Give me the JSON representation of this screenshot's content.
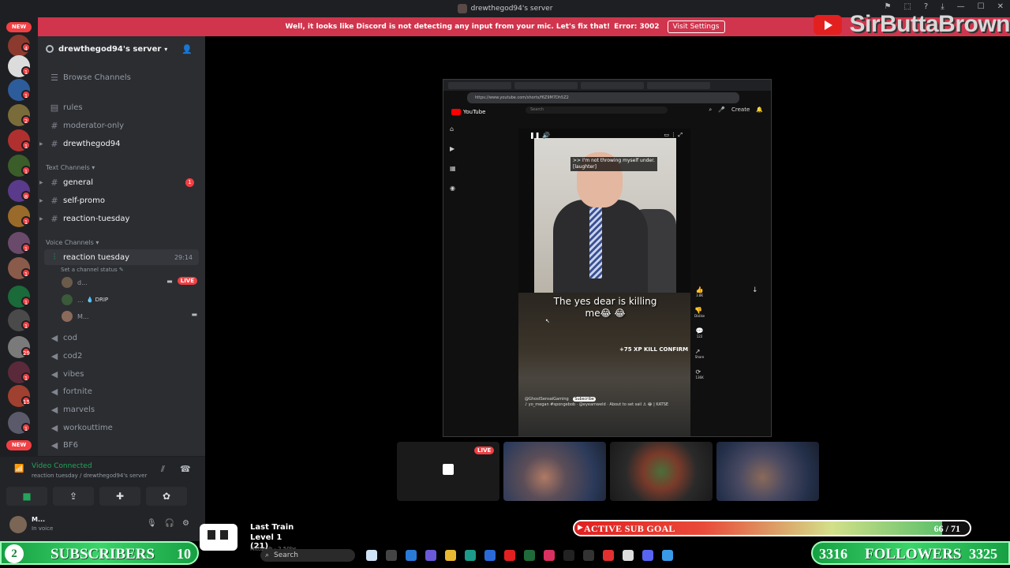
{
  "window": {
    "title": "drewthegod94's server",
    "controls": [
      "⚑",
      "⬚",
      "?",
      "⤓",
      "—",
      "☐",
      "✕"
    ]
  },
  "notice": {
    "text": "Well, it looks like Discord is not detecting any input from your mic. Let's fix that!",
    "error": "Error: 3002",
    "button": "Visit Settings"
  },
  "brand": {
    "name": "SirButtaBrown"
  },
  "rail": {
    "new_top": "NEW",
    "new_bottom": "NEW",
    "badges": [
      "4",
      "1",
      "1",
      "2",
      "1",
      "1",
      "8",
      "1",
      "1",
      "1",
      "1",
      "1",
      "29",
      "1",
      "15",
      "1",
      "1"
    ]
  },
  "server": {
    "name": "drewthegod94's server",
    "browse": "Browse Channels"
  },
  "channels": {
    "top": [
      {
        "name": "rules"
      },
      {
        "name": "moderator-only"
      },
      {
        "name": "drewthegod94"
      }
    ],
    "text_category": "Text Channels",
    "text": [
      {
        "name": "general",
        "badge": "1"
      },
      {
        "name": "self-promo"
      },
      {
        "name": "reaction-tuesday"
      }
    ],
    "voice_category": "Voice Channels",
    "active_voice": {
      "name": "reaction tuesday",
      "time": "29:14",
      "status": "Set a channel status"
    },
    "voice_users": [
      {
        "name": "d...",
        "live": "LIVE"
      },
      {
        "name": "...",
        "tag": "DRIP"
      },
      {
        "name": "M..."
      }
    ],
    "voice": [
      {
        "name": "cod"
      },
      {
        "name": "cod2"
      },
      {
        "name": "vibes"
      },
      {
        "name": "fortnite"
      },
      {
        "name": "marvels"
      },
      {
        "name": "workouttime"
      },
      {
        "name": "BF6"
      }
    ]
  },
  "voice_panel": {
    "title": "Video Connected",
    "subtitle": "reaction tuesday / drewthegod94's server"
  },
  "user_panel": {
    "name": "M...",
    "status": "In voice"
  },
  "stream": {
    "url": "https://www.youtube.com/shorts/f6Z9M7Dh5Z2",
    "site": "YouTube",
    "search": "Search",
    "create": "Create",
    "top_caption": ">> I'm not throwing myself under. [laughter]",
    "caption": "The yes dear is killing me😂 😂",
    "xp": "+75 XP   KILL CONFIRM",
    "channel": "@GhostSensaiGaming",
    "subscribe": "Subscribe",
    "footer": "♪ yo_megan #spongebob · @eyeamweld · About to set sail ⚓ 😂 | KATSE",
    "likes": "3.8K",
    "dislike": "Dislike",
    "comments": "122",
    "share": "Share",
    "remix": "136K"
  },
  "tiles": {
    "live_label": "LIVE"
  },
  "now_playing": {
    "title": "Last Train",
    "level": "Level 1 (21)",
    "artist": "Hittaryh · 2.50bs"
  },
  "sub_goal": {
    "label": "ACTIVE SUB GOAL",
    "current": 66,
    "target": 71,
    "count_text": "66 / 71"
  },
  "subscribers": {
    "count_left": "2",
    "label": "SUBSCRIBERS",
    "count_right": "10"
  },
  "followers": {
    "count_left": "3316",
    "label": "FOLLOWERS",
    "count_right": "3325"
  },
  "taskbar": {
    "search": "Search"
  },
  "colors": {
    "discord_bg": "#2b2d31",
    "alert_red": "#d0354d",
    "voice_green": "#23a55a",
    "overlay_green": "#3bd36a"
  }
}
